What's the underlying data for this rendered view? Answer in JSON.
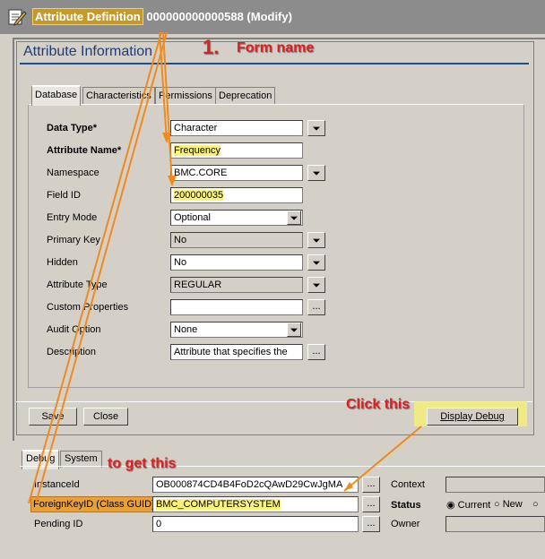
{
  "window": {
    "title_prefix": "Attribute Definition",
    "title_id": "000000000000588 (Modify)"
  },
  "section_title": "Attribute Information",
  "tabs": [
    {
      "label": "Database"
    },
    {
      "label": "Characteristics"
    },
    {
      "label": "Permissions"
    },
    {
      "label": "Deprecation"
    }
  ],
  "fields": {
    "data_type": {
      "label": "Data Type*",
      "value": "Character"
    },
    "attribute_name": {
      "label": "Attribute Name*",
      "value": "Frequency"
    },
    "namespace": {
      "label": "Namespace",
      "value": "BMC.CORE"
    },
    "field_id": {
      "label": "Field ID",
      "value": "200000035"
    },
    "entry_mode": {
      "label": "Entry Mode",
      "value": "Optional"
    },
    "primary_key": {
      "label": "Primary Key",
      "value": "No"
    },
    "hidden": {
      "label": "Hidden",
      "value": "No"
    },
    "attribute_type": {
      "label": "Attribute Type",
      "value": "REGULAR"
    },
    "custom_properties": {
      "label": "Custom Properties",
      "value": ""
    },
    "audit_option": {
      "label": "Audit Option",
      "value": "None"
    },
    "description": {
      "label": "Description",
      "value": "Attribute that specifies the"
    }
  },
  "buttons": {
    "save": "Save",
    "close": "Close",
    "display_debug": "Display Debug",
    "ellipsis": "..."
  },
  "debug": {
    "tabs": [
      {
        "label": "Debug"
      },
      {
        "label": "System"
      }
    ],
    "instance_id": {
      "label": "InstanceId",
      "value": "OB000874CD4B4FoD2cQAwD29CwJgMA"
    },
    "foreign_key_id": {
      "label": "ForeignKeyID (Class GUID)",
      "value": "BMC_COMPUTERSYSTEM"
    },
    "pending_id": {
      "label": "Pending ID",
      "value": "0"
    },
    "context_label": "Context",
    "status_label": "Status",
    "owner_label": "Owner",
    "status_options": [
      "Current",
      "New",
      ""
    ]
  },
  "annotations": {
    "step_number": "1.",
    "form_name": "Form name",
    "click_this": "Click this",
    "to_get_this": "to get this"
  },
  "colors": {
    "annotation_red": "#e02020",
    "highlight_yellow": "#fbf27a",
    "arrow_orange": "#f08a1c"
  }
}
